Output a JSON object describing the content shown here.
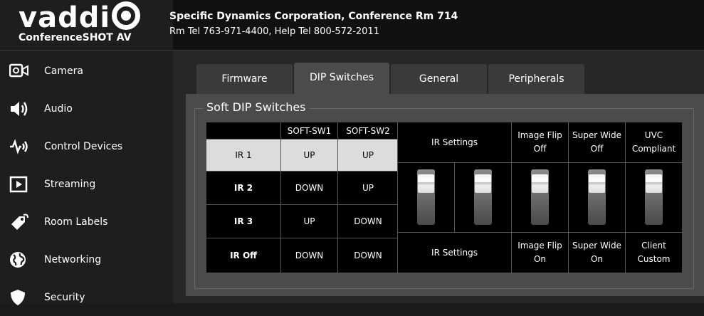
{
  "brand": {
    "logo": "vaddio",
    "product": "ConferenceSHOT AV"
  },
  "room": {
    "name": "Specific Dynamics Corporation, Conference Rm 714",
    "tel": "Rm Tel 763-971-4400, Help Tel 800-572-2011"
  },
  "sidebar": {
    "items": [
      {
        "label": "Camera",
        "icon": "camera-icon"
      },
      {
        "label": "Audio",
        "icon": "speaker-icon"
      },
      {
        "label": "Control Devices",
        "icon": "control-devices-icon"
      },
      {
        "label": "Streaming",
        "icon": "play-icon"
      },
      {
        "label": "Room Labels",
        "icon": "tag-icon"
      },
      {
        "label": "Networking",
        "icon": "globe-icon"
      },
      {
        "label": "Security",
        "icon": "shield-icon"
      }
    ]
  },
  "tabs": [
    {
      "label": "Firmware"
    },
    {
      "label": "DIP Switches",
      "active": true
    },
    {
      "label": "General"
    },
    {
      "label": "Peripherals"
    }
  ],
  "dip": {
    "title": "Soft DIP Switches",
    "headers": [
      "",
      "SOFT-SW1",
      "SOFT-SW2"
    ],
    "rows": [
      {
        "name": "IR 1",
        "sw1": "UP",
        "sw2": "UP",
        "selected": true
      },
      {
        "name": "IR 2",
        "sw1": "DOWN",
        "sw2": "UP"
      },
      {
        "name": "IR 3",
        "sw1": "UP",
        "sw2": "DOWN"
      },
      {
        "name": "IR Off",
        "sw1": "DOWN",
        "sw2": "DOWN"
      }
    ]
  },
  "switches": {
    "top": {
      "ir": "IR Settings",
      "flip": "Image Flip\nOff",
      "wide": "Super Wide\nOff",
      "uvc": "UVC\nCompliant"
    },
    "bottom": {
      "ir": "IR Settings",
      "flip": "Image Flip\nOn",
      "wide": "Super Wide\nOn",
      "uvc": "Client\nCustom"
    }
  },
  "colors": {
    "accent_highlight": "#dcdcdc",
    "panel": "#4b4b4b",
    "header": "#111111"
  }
}
